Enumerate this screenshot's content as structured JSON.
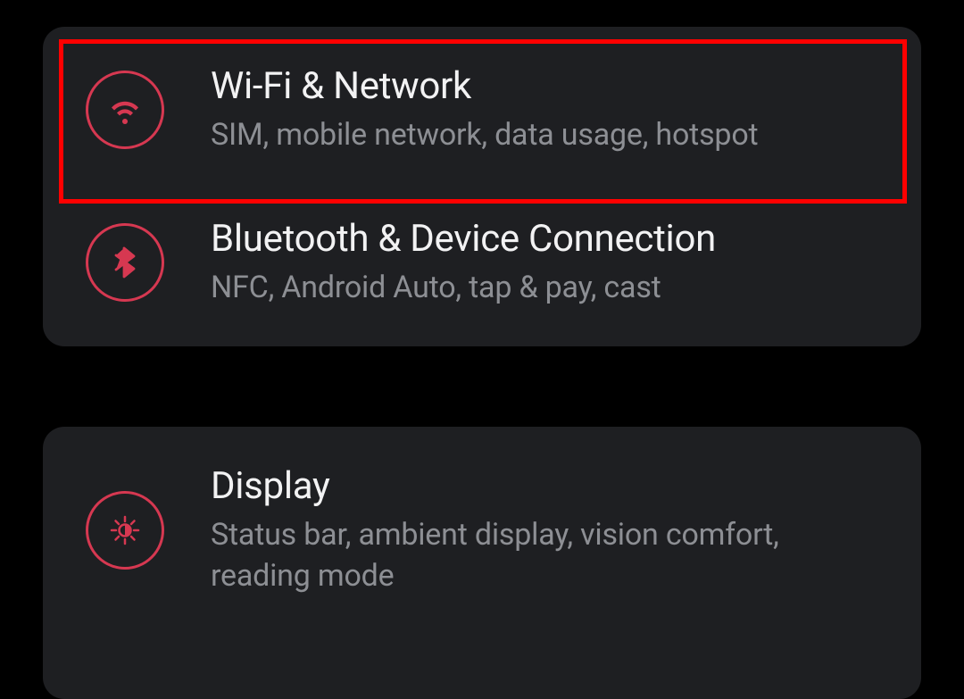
{
  "settings": {
    "groups": [
      {
        "items": [
          {
            "id": "wifi-network",
            "icon": "wifi-icon",
            "title": "Wi-Fi & Network",
            "subtitle": "SIM, mobile network, data usage, hotspot",
            "highlighted": true
          },
          {
            "id": "bluetooth-device",
            "icon": "bluetooth-icon",
            "title": "Bluetooth & Device Connection",
            "subtitle": "NFC, Android Auto, tap & pay, cast",
            "highlighted": false
          }
        ]
      },
      {
        "items": [
          {
            "id": "display",
            "icon": "brightness-icon",
            "title": "Display",
            "subtitle": "Status bar, ambient display, vision comfort, reading mode",
            "highlighted": false
          }
        ]
      }
    ]
  },
  "colors": {
    "accent": "#d63851",
    "highlight_border": "#ff0000",
    "card_bg": "#1e1f22",
    "title_text": "#f2f2f3",
    "subtitle_text": "#8d8f94"
  }
}
